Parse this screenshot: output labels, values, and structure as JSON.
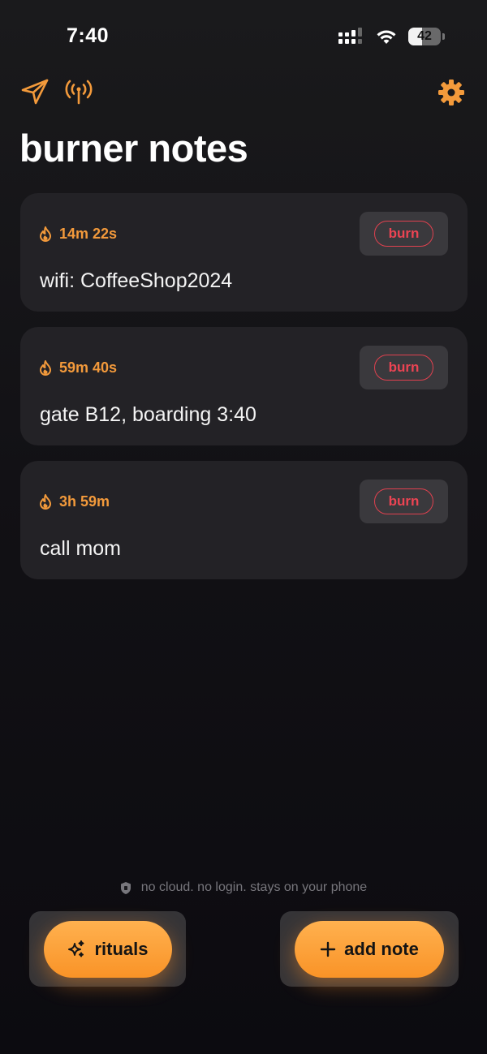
{
  "status_bar": {
    "time": "7:40",
    "battery_level": 42,
    "battery_text": "42"
  },
  "toolbar": {
    "send_icon": "paper-plane-icon",
    "broadcast_icon": "antenna-icon",
    "settings_icon": "gear-icon"
  },
  "title": "burner notes",
  "notes": [
    {
      "timer": "14m 22s",
      "text": "wifi: CoffeeShop2024",
      "burn_label": "burn"
    },
    {
      "timer": "59m 40s",
      "text": "gate B12, boarding 3:40",
      "burn_label": "burn"
    },
    {
      "timer": "3h 59m",
      "text": "call mom",
      "burn_label": "burn"
    }
  ],
  "footer": {
    "privacy_text": "no cloud. no login. stays on your phone",
    "rituals_label": "rituals",
    "add_note_label": "add note"
  },
  "colors": {
    "accent": "#f99327",
    "timer": "#f39a3b",
    "burn": "#ec4453",
    "card": "#232226",
    "background": "#121115"
  }
}
